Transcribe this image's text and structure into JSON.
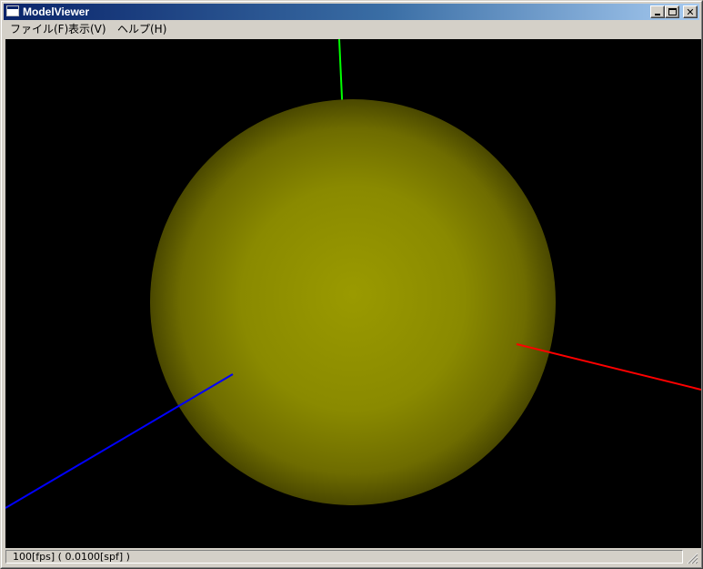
{
  "window": {
    "title": "ModelViewer"
  },
  "caption_buttons": {
    "minimize": "minimize",
    "maximize": "maximize",
    "close": "close"
  },
  "menu": {
    "items": [
      {
        "label": "ファイル(F)"
      },
      {
        "label": "表示(V)"
      },
      {
        "label": "ヘルプ(H)"
      }
    ]
  },
  "scene": {
    "background": "#000000",
    "sphere_color": "#999900",
    "axis_colors": {
      "x": "#ff0000",
      "y": "#00ff00",
      "z": "#0000ff"
    }
  },
  "status": {
    "text": "100[fps] ( 0.0100[spf] )"
  },
  "colors": {
    "title_start": "#0a246a",
    "title_end": "#a6caf0",
    "chrome": "#d4d0c8"
  }
}
